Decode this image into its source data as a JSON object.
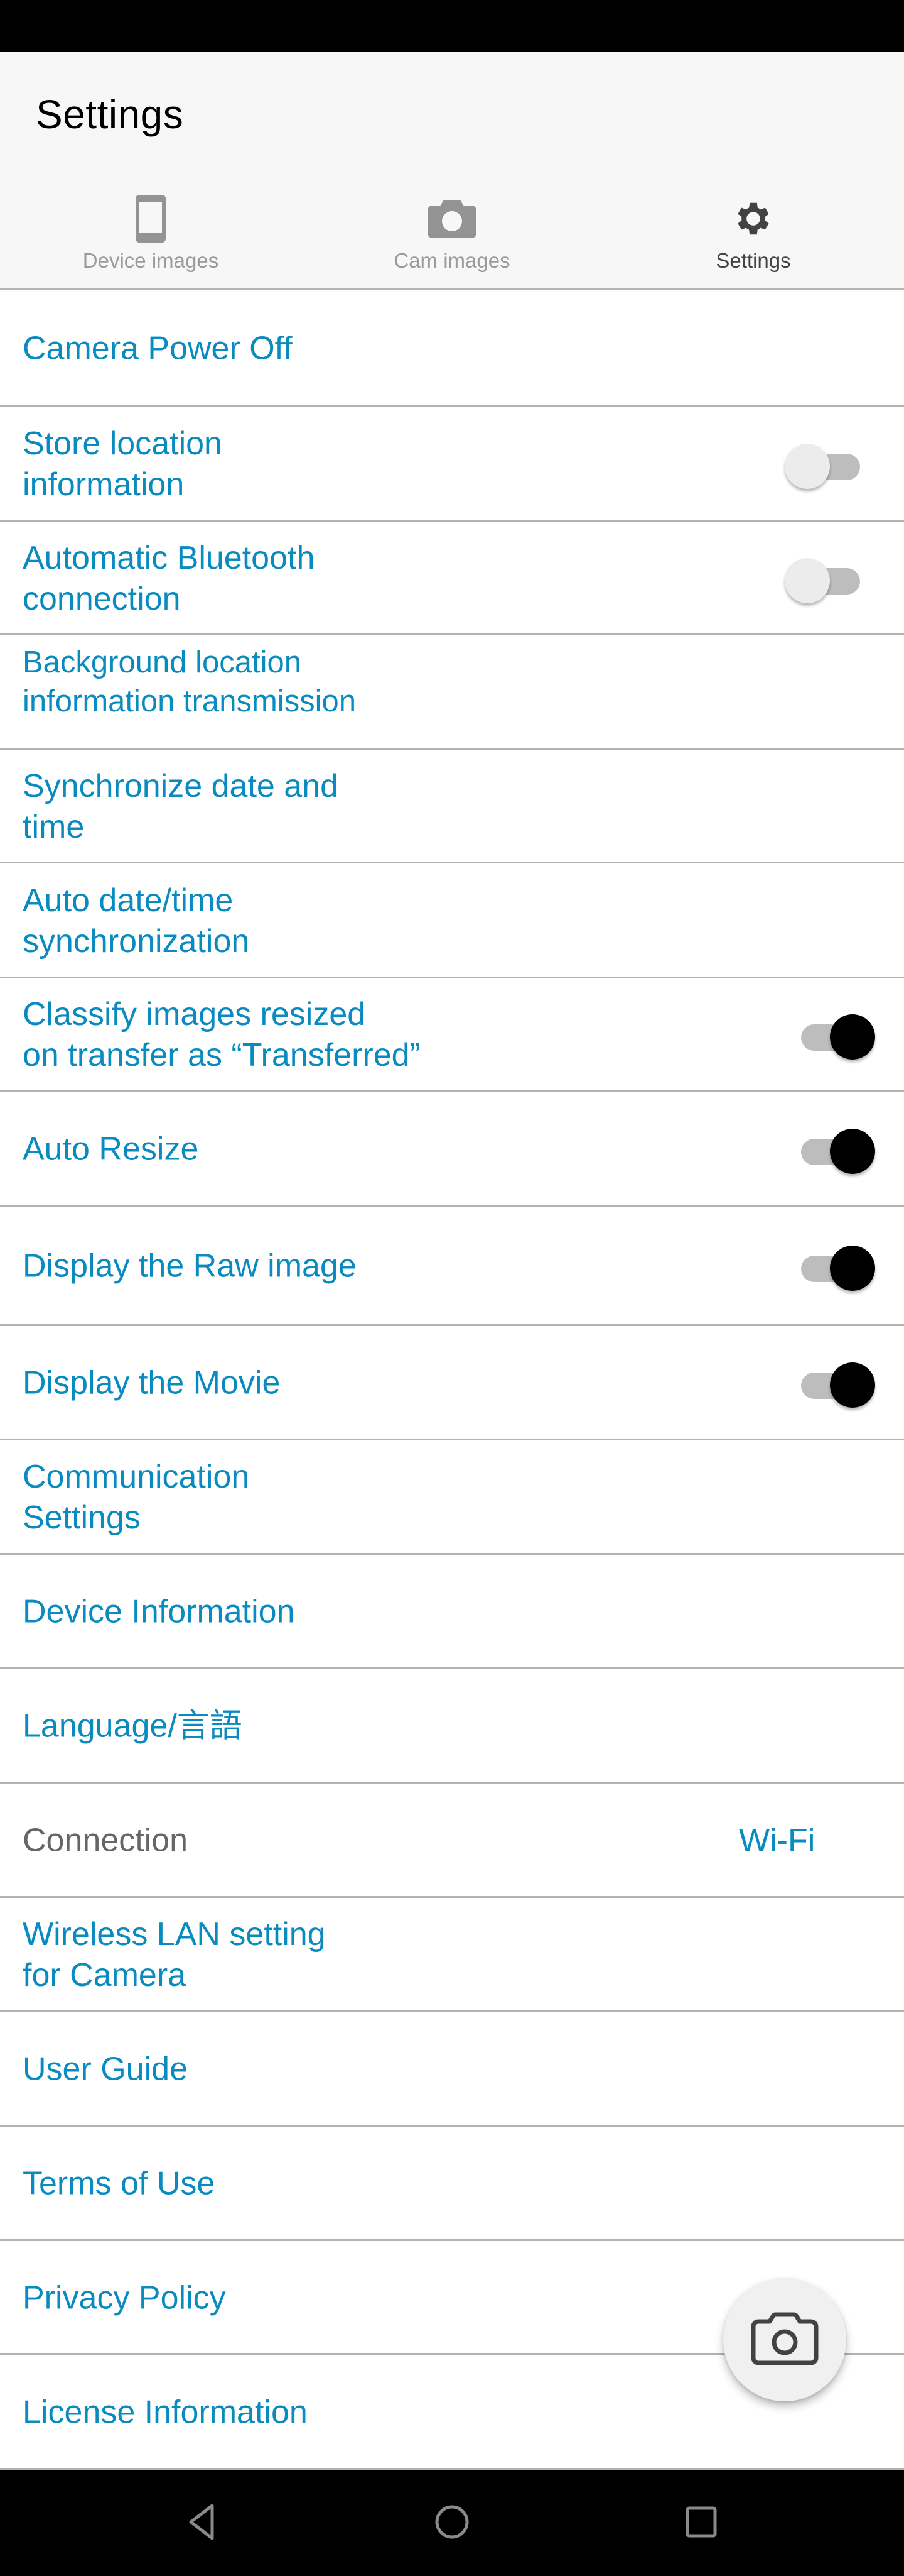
{
  "header": {
    "title": "Settings",
    "tabs": [
      {
        "label": "Device images",
        "icon": "phone-icon",
        "active": false
      },
      {
        "label": "Cam images",
        "icon": "camera-icon",
        "active": false
      },
      {
        "label": "Settings",
        "icon": "gear-icon",
        "active": true
      }
    ]
  },
  "settings": {
    "items": [
      {
        "label": "Camera Power Off",
        "type": "link"
      },
      {
        "label": "Store location\ninformation",
        "type": "toggle",
        "checked": false
      },
      {
        "label": "Automatic Bluetooth\nconnection",
        "type": "toggle",
        "checked": false
      },
      {
        "label": "Background location\ninformation transmission",
        "type": "link"
      },
      {
        "label": "Synchronize date and\ntime",
        "type": "link"
      },
      {
        "label": "Auto date/time\nsynchronization",
        "type": "link"
      },
      {
        "label": "Classify images resized\non transfer as “Transferred”",
        "type": "toggle",
        "checked": true
      },
      {
        "label": "Auto Resize",
        "type": "toggle",
        "checked": true
      },
      {
        "label": "Display the Raw image",
        "type": "toggle",
        "checked": true
      },
      {
        "label": "Display the Movie",
        "type": "toggle",
        "checked": true
      },
      {
        "label": "Communication\nSettings",
        "type": "link"
      },
      {
        "label": "Device Information",
        "type": "link"
      },
      {
        "label": "Language/言語",
        "type": "link"
      },
      {
        "label": "Connection",
        "type": "value",
        "value": "Wi-Fi"
      },
      {
        "label": "Wireless LAN setting\nfor Camera",
        "type": "link"
      },
      {
        "label": "User Guide",
        "type": "link"
      },
      {
        "label": "Terms of Use",
        "type": "link"
      },
      {
        "label": "Privacy Policy",
        "type": "link"
      },
      {
        "label": "License Information",
        "type": "link"
      }
    ]
  },
  "fab": {
    "icon": "camera-outline-icon"
  },
  "navigation": {
    "back": "back-icon",
    "home": "home-icon",
    "recents": "recents-icon"
  },
  "colors": {
    "accent_text": "#0a8bc0",
    "secondary_text": "#666666",
    "divider": "#b3b3b3",
    "header_bg": "#f7f7f7",
    "toggle_track": "#bdbdbd",
    "toggle_thumb_on": "#000000",
    "toggle_thumb_off": "#ececec"
  }
}
